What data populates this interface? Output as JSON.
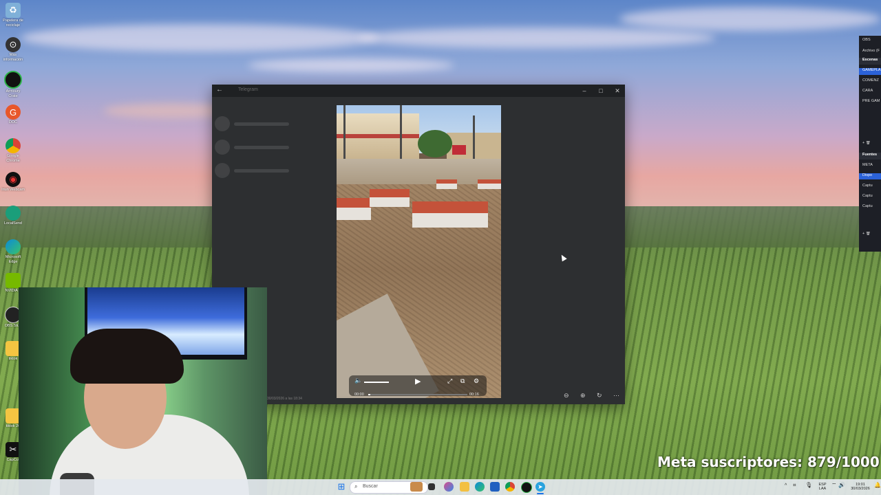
{
  "desktop": {
    "icons": [
      {
        "label": "Papelera de reciclaje",
        "icon": "recycle-bin-icon"
      },
      {
        "label": "Más información",
        "icon": "info-icon"
      },
      {
        "label": "Armoury Crate",
        "icon": "armoury-crate-icon"
      },
      {
        "label": "DOC",
        "icon": "doc-app-icon"
      },
      {
        "label": "Google Chrome",
        "icon": "chrome-icon"
      },
      {
        "label": "Iriun Webcam",
        "icon": "webcam-app-icon"
      },
      {
        "label": "LocalSend",
        "icon": "localsend-icon"
      },
      {
        "label": "Microsoft Edge",
        "icon": "edge-icon"
      },
      {
        "label": "NVIDIA A",
        "icon": "nvidia-icon"
      },
      {
        "label": "OBS Stud",
        "icon": "obs-icon"
      },
      {
        "label": "tiktok",
        "icon": "folder-icon"
      },
      {
        "label": "tiktok 20",
        "icon": "folder-icon"
      },
      {
        "label": "CapCut",
        "icon": "capcut-icon"
      }
    ]
  },
  "telegram_viewer": {
    "app_title": "Telegram",
    "date_caption": "30/03/2026 a las 18:34",
    "video": {
      "current_time": "00:00",
      "duration": "00:16",
      "progress": 0.02
    }
  },
  "overlay": {
    "meta_text": "Meta suscriptores: 879/1000"
  },
  "obs": {
    "menu": "Archivo (F",
    "scenes_header": "Escenas",
    "scenes": [
      "GAMEPLA",
      "COMENZ",
      "CARA",
      "PRE GAM"
    ],
    "sources_header": "Fuentes",
    "sources": [
      "META",
      "Dispo",
      "Captu",
      "Captu",
      "Captu"
    ]
  },
  "taskbar": {
    "search_placeholder": "Buscar",
    "language": "ESP",
    "region": "LAA",
    "time": "19:01",
    "date": "30/03/2026"
  }
}
